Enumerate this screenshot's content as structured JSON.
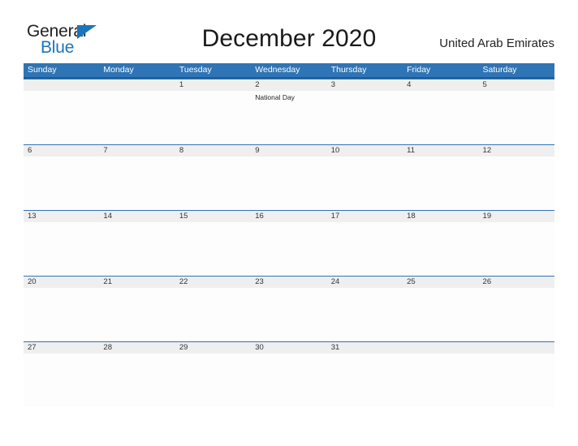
{
  "branding": {
    "logo_text_primary": "General",
    "logo_text_secondary": "Blue",
    "flag_icon": "blue-triangle-flag-icon"
  },
  "header": {
    "title": "December 2020",
    "country": "United Arab Emirates"
  },
  "colors": {
    "header_blue": "#2f74b5",
    "header_blue_dark": "#1f5c96",
    "band_gray": "#efefef",
    "logo_blue": "#1b75bb",
    "text_dark": "#231f20"
  },
  "calendar": {
    "weekdays": [
      "Sunday",
      "Monday",
      "Tuesday",
      "Wednesday",
      "Thursday",
      "Friday",
      "Saturday"
    ],
    "weeks": [
      {
        "days": [
          {
            "date": "",
            "event": ""
          },
          {
            "date": "",
            "event": ""
          },
          {
            "date": "1",
            "event": ""
          },
          {
            "date": "2",
            "event": "National Day"
          },
          {
            "date": "3",
            "event": ""
          },
          {
            "date": "4",
            "event": ""
          },
          {
            "date": "5",
            "event": ""
          }
        ]
      },
      {
        "days": [
          {
            "date": "6",
            "event": ""
          },
          {
            "date": "7",
            "event": ""
          },
          {
            "date": "8",
            "event": ""
          },
          {
            "date": "9",
            "event": ""
          },
          {
            "date": "10",
            "event": ""
          },
          {
            "date": "11",
            "event": ""
          },
          {
            "date": "12",
            "event": ""
          }
        ]
      },
      {
        "days": [
          {
            "date": "13",
            "event": ""
          },
          {
            "date": "14",
            "event": ""
          },
          {
            "date": "15",
            "event": ""
          },
          {
            "date": "16",
            "event": ""
          },
          {
            "date": "17",
            "event": ""
          },
          {
            "date": "18",
            "event": ""
          },
          {
            "date": "19",
            "event": ""
          }
        ]
      },
      {
        "days": [
          {
            "date": "20",
            "event": ""
          },
          {
            "date": "21",
            "event": ""
          },
          {
            "date": "22",
            "event": ""
          },
          {
            "date": "23",
            "event": ""
          },
          {
            "date": "24",
            "event": ""
          },
          {
            "date": "25",
            "event": ""
          },
          {
            "date": "26",
            "event": ""
          }
        ]
      },
      {
        "days": [
          {
            "date": "27",
            "event": ""
          },
          {
            "date": "28",
            "event": ""
          },
          {
            "date": "29",
            "event": ""
          },
          {
            "date": "30",
            "event": ""
          },
          {
            "date": "31",
            "event": ""
          },
          {
            "date": "",
            "event": ""
          },
          {
            "date": "",
            "event": ""
          }
        ]
      }
    ]
  }
}
